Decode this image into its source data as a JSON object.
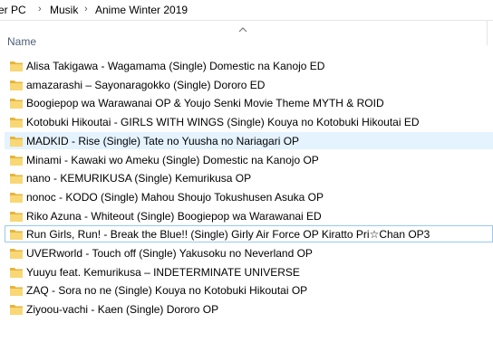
{
  "breadcrumb": {
    "items": [
      "er PC",
      "Musik",
      "Anime Winter 2019"
    ],
    "separator": "›"
  },
  "header": {
    "column_name": "Name",
    "sort_icon": "chevron-up-icon"
  },
  "colors": {
    "folder": "#f8d775",
    "folder_dark": "#e5b53b",
    "hover": "#e5f3ff",
    "header_text": "#4c607a"
  },
  "files": [
    {
      "name": "Alisa Takigawa - Wagamama (Single) Domestic na Kanojo ED",
      "icon": "folder-icon"
    },
    {
      "name": "amazarashi – Sayonaragokko (Single) Dororo ED",
      "icon": "folder-icon"
    },
    {
      "name": "Boogiepop wa Warawanai OP & Youjo Senki Movie Theme  MYTH & ROID",
      "icon": "folder-icon"
    },
    {
      "name": "Kotobuki Hikoutai - GIRLS WITH WINGS (Single) Kouya no Kotobuki Hikoutai ED",
      "icon": "folder-icon"
    },
    {
      "name": "MADKID - Rise (Single) Tate no Yuusha no Nariagari OP",
      "icon": "folder-icon",
      "state": "hover"
    },
    {
      "name": "Minami - Kawaki wo Ameku (Single) Domestic na Kanojo OP",
      "icon": "folder-icon"
    },
    {
      "name": "nano - KEMURIKUSA (Single) Kemurikusa OP",
      "icon": "folder-icon"
    },
    {
      "name": "nonoc - KODO (Single) Mahou Shoujo Tokushusen Asuka OP",
      "icon": "folder-icon"
    },
    {
      "name": "Riko Azuna - Whiteout (Single) Boogiepop wa Warawanai ED",
      "icon": "folder-icon"
    },
    {
      "name": "Run Girls, Run! - Break the Blue!! (Single) Girly Air Force OP  Kiratto Pri☆Chan OP3",
      "icon": "folder-icon",
      "state": "focused"
    },
    {
      "name": "UVERworld -  Touch off (Single) Yakusoku no Neverland OP",
      "icon": "folder-icon"
    },
    {
      "name": "Yuuyu feat. Kemurikusa – INDETERMINATE UNIVERSE",
      "icon": "folder-icon"
    },
    {
      "name": "ZAQ - Sora no ne (Single) Kouya no Kotobuki Hikoutai OP",
      "icon": "folder-icon"
    },
    {
      "name": "Ziyoou-vachi - Kaen (Single) Dororo OP",
      "icon": "folder-icon"
    }
  ]
}
